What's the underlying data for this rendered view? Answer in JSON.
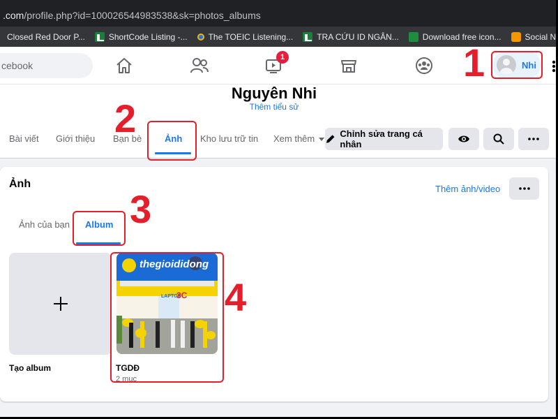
{
  "browser": {
    "url_host": ".com",
    "url_rest": "/profile.php?id=100026544983538&sk=photos_albums",
    "bookmarks": [
      {
        "label": "Closed Red Door P...",
        "icon": "none"
      },
      {
        "label": "ShortCode Listing -...",
        "icon": "sheets-icon"
      },
      {
        "label": "The TOEIC Listening...",
        "icon": "toeic-icon"
      },
      {
        "label": "TRA CỨU ID NGÂN...",
        "icon": "sheets-icon"
      },
      {
        "label": "Download free icon...",
        "icon": "flaticon-icon"
      },
      {
        "label": "Social Network for...",
        "icon": "social-icon"
      }
    ]
  },
  "nav": {
    "search_placeholder": "cebook",
    "watch_badge": "1",
    "profile_name": "Nhi"
  },
  "profile": {
    "name": "Nguyên Nhi",
    "bio_link": "Thêm tiểu sử",
    "tabs": [
      "Bài viết",
      "Giới thiệu",
      "Bạn bè",
      "Ảnh",
      "Kho lưu trữ tin",
      "Xem thêm"
    ],
    "active_tab": "Ảnh",
    "edit_button": "Chỉnh sửa trang cá nhân"
  },
  "photos": {
    "title": "Ảnh",
    "add_link": "Thêm ảnh/video",
    "subtabs": [
      "Ảnh của bạn",
      "Album"
    ],
    "active_subtab": "Album",
    "create_album_label": "Tạo album",
    "albums": [
      {
        "name": "TGDĐ",
        "count": "2 mục",
        "thumb_text": "thegioididong",
        "thumb_sign": "LAPTOP",
        "thumb_sign2": "3C"
      }
    ]
  },
  "annotations": [
    "1",
    "2",
    "3",
    "4"
  ],
  "colors": {
    "accent": "#1877f2",
    "annotation": "#e41e2b",
    "badge": "#e41e3f"
  }
}
